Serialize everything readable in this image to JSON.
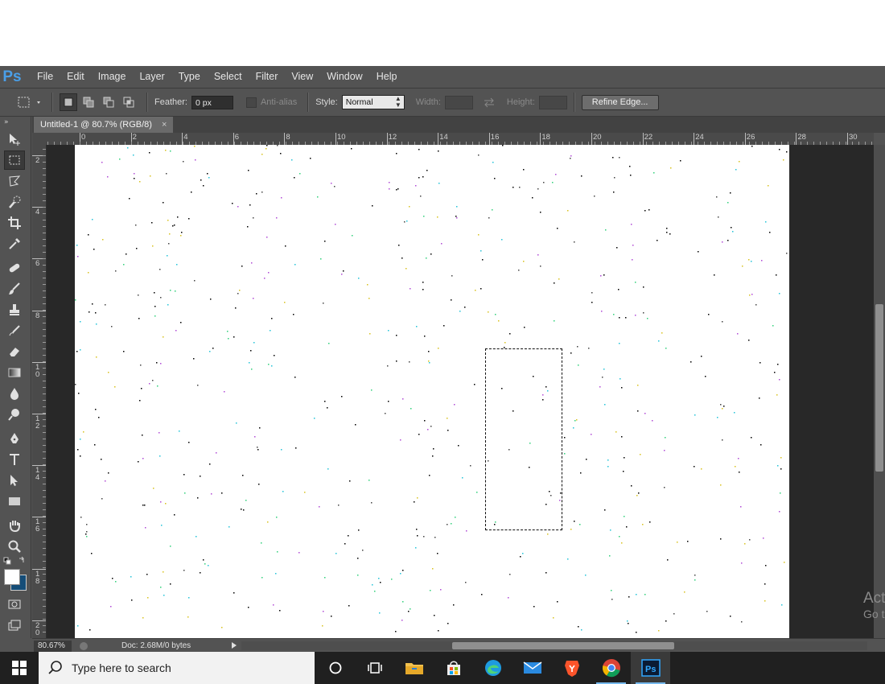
{
  "menubar": {
    "logo": "Ps",
    "items": [
      "File",
      "Edit",
      "Image",
      "Layer",
      "Type",
      "Select",
      "Filter",
      "View",
      "Window",
      "Help"
    ]
  },
  "options": {
    "feather_label": "Feather:",
    "feather_value": "0 px",
    "antialias_label": "Anti-alias",
    "style_label": "Style:",
    "style_value": "Normal",
    "width_label": "Width:",
    "height_label": "Height:",
    "refine_button": "Refine Edge..."
  },
  "document": {
    "tab_title": "Untitled-1 @ 80.7% (RGB/8)",
    "close_glyph": "×"
  },
  "ruler": {
    "h_labels": [
      "0",
      "2",
      "4",
      "6",
      "8",
      "10",
      "12",
      "14",
      "16",
      "18",
      "20",
      "22",
      "24",
      "26",
      "28",
      "30"
    ],
    "v_labels": [
      "2",
      "4",
      "6",
      "8",
      "10",
      "12",
      "14",
      "16",
      "18",
      "20"
    ]
  },
  "status": {
    "zoom": "80.67%",
    "doc": "Doc: 2.68M/0 bytes"
  },
  "watermark": {
    "line1": "Act",
    "line2": "Go t"
  },
  "taskbar": {
    "search_placeholder": "Type here to search",
    "apps": [
      "cortana-icon",
      "task-view-icon",
      "file-explorer-icon",
      "store-icon",
      "edge-icon",
      "mail-icon",
      "brave-icon",
      "chrome-icon",
      "photoshop-icon"
    ]
  },
  "colors": {
    "accent": "#4a9fe8",
    "panel": "#535353",
    "workspace": "#282828",
    "canvas": "#ffffff"
  }
}
